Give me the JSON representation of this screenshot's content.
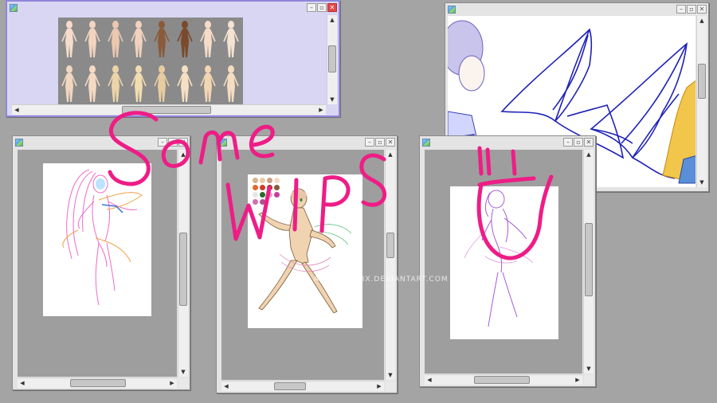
{
  "app": {
    "name": "paint-canvas-windows"
  },
  "watermark": {
    "text": "© AIRAYAMAGIX.DEVIANTART.COM"
  },
  "overlay_text": "Some WIPS !! U",
  "colors": {
    "desktop": "#a4a4a4",
    "active_title": "#8f86d8",
    "sketch_pink": "#f06ac8",
    "sketch_purple": "#a65ad8",
    "lineart_blue": "#1e22b8",
    "handwriting": "#ee1d86"
  },
  "icons": [
    "app-icon",
    "minimize-icon",
    "maximize-icon",
    "close-icon",
    "scroll-up-arrow",
    "scroll-down-arrow",
    "scroll-left-arrow",
    "scroll-right-arrow"
  ],
  "palette": [
    "#d8b08a",
    "#e8c8a6",
    "#c8a088",
    "#f2dac4",
    "#e06a2a",
    "#d23a2a",
    "#a23a2a",
    "#8a5a3a",
    "#e6e6e6",
    "#2a6a2a",
    "#f0a0c8",
    "#c040a0",
    "#d070b0",
    "#b05090"
  ],
  "bases": [
    "#f6dccb",
    "#f3d4c0",
    "#ecc8b0",
    "#f0d2bd",
    "#8a5a3a",
    "#7a4a2c",
    "#f6dcc8",
    "#f4e2d2",
    "#f1d6c0",
    "#f5d9c3",
    "#ecd4a8",
    "#f1ddb0",
    "#e8cba0",
    "#f6e0c4",
    "#f2d6b4",
    "#f5dcc0"
  ]
}
